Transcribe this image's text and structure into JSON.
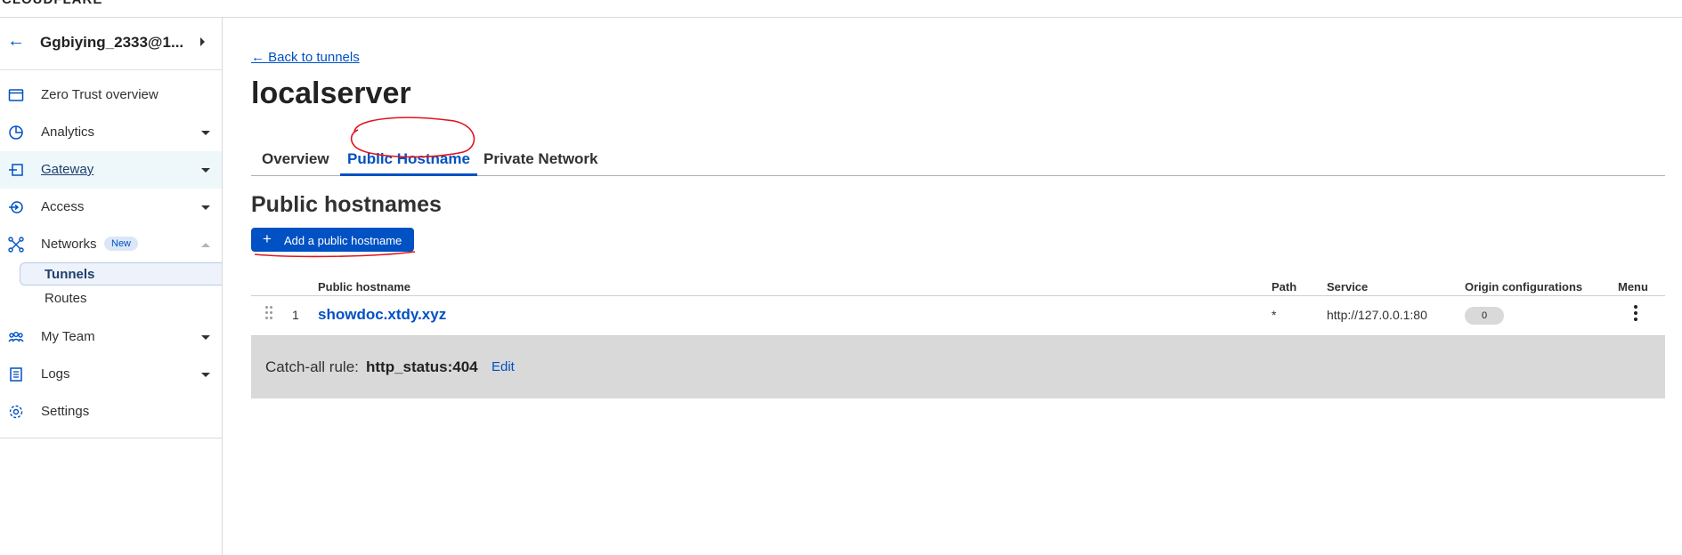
{
  "topbar": {
    "brand": "CLOUDFLARE"
  },
  "account": {
    "name": "Ggbiying_2333@1..."
  },
  "sidebar": {
    "items": [
      {
        "label": "Zero Trust overview",
        "icon": "browser-window-icon"
      },
      {
        "label": "Analytics",
        "icon": "pie-chart-icon"
      },
      {
        "label": "Gateway",
        "icon": "gateway-icon"
      },
      {
        "label": "Access",
        "icon": "access-icon"
      },
      {
        "label": "Networks",
        "icon": "network-icon",
        "badge": "New"
      },
      {
        "label": "My Team",
        "icon": "team-icon"
      },
      {
        "label": "Logs",
        "icon": "logs-icon"
      },
      {
        "label": "Settings",
        "icon": "gear-icon"
      }
    ],
    "subitems": [
      {
        "label": "Tunnels"
      },
      {
        "label": "Routes"
      }
    ]
  },
  "main": {
    "back_link": "← Back to tunnels",
    "title": "localserver",
    "tabs": [
      {
        "label": "Overview"
      },
      {
        "label": "Public Hostname"
      },
      {
        "label": "Private Network"
      }
    ],
    "section_title": "Public hostnames",
    "add_button": "Add a public hostname",
    "table": {
      "headers": [
        "Public hostname",
        "Path",
        "Service",
        "Origin configurations",
        "Menu"
      ],
      "rows": [
        {
          "index": "1",
          "hostname": "showdoc.xtdy.xyz",
          "path": "*",
          "service": "http://127.0.0.1:80",
          "origin_configurations": "0"
        }
      ]
    },
    "catch_all": {
      "label": "Catch-all rule:",
      "value": "http_status:404",
      "edit": "Edit"
    }
  },
  "colors": {
    "accent": "#0051c3",
    "annotation": "#e0141e"
  }
}
